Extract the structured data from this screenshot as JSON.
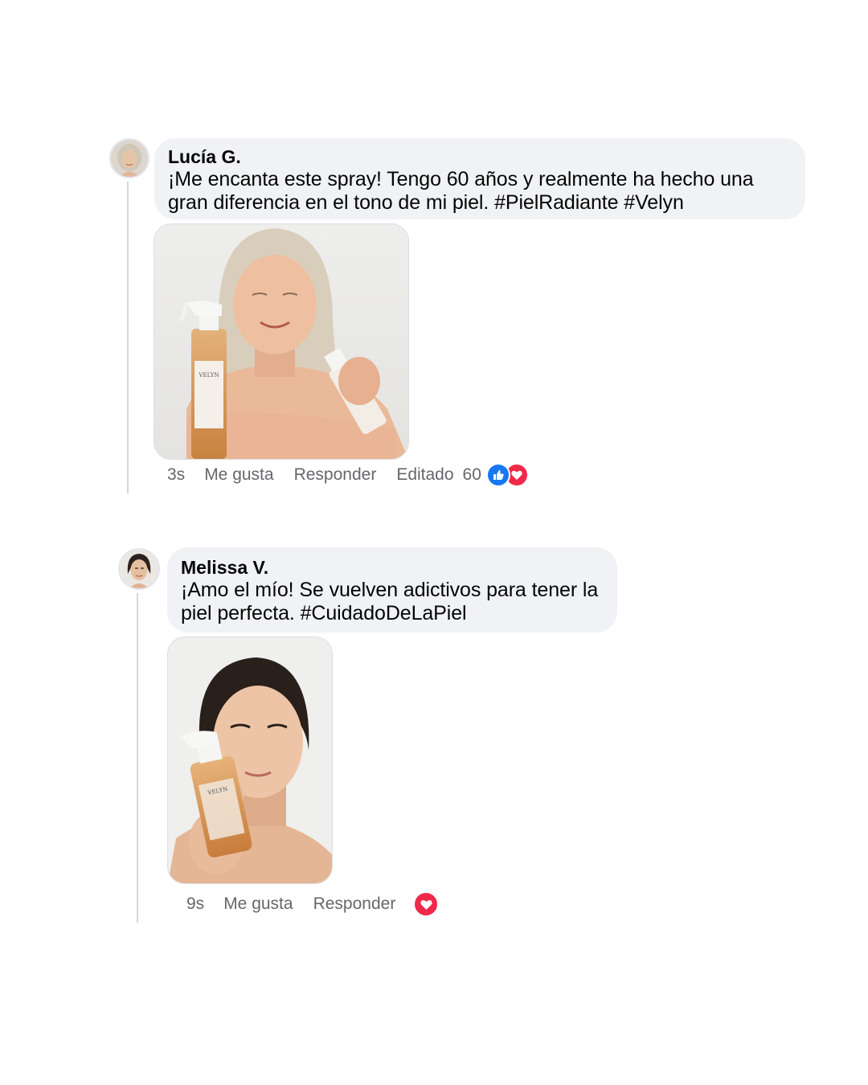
{
  "comments": [
    {
      "author": "Lucía G.",
      "text_line1": "¡Me encanta este spray! Tengo 60 años y realmente ha hecho una",
      "text_line2": "gran diferencia en el tono de mi piel. #PielRadiante #Velyn",
      "photo_brand_label": "VELYN",
      "time": "3s",
      "like_label": "Me gusta",
      "reply_label": "Responder",
      "edited_label": "Editado",
      "reaction_count": "60",
      "reactions": [
        "like-icon",
        "love-icon"
      ]
    },
    {
      "author": "Melissa V.",
      "text_line1": "¡Amo el mío! Se vuelven adictivos para tener la",
      "text_line2": "piel perfecta. #CuidadoDeLaPiel",
      "photo_brand_label": "VELYN",
      "time": "9s",
      "like_label": "Me gusta",
      "reply_label": "Responder",
      "reactions": [
        "love-icon"
      ]
    }
  ],
  "colors": {
    "bubble_bg": "#f0f2f5",
    "meta_text": "#65676b",
    "like_blue": "#1877f2",
    "love_red": "#f02849"
  }
}
